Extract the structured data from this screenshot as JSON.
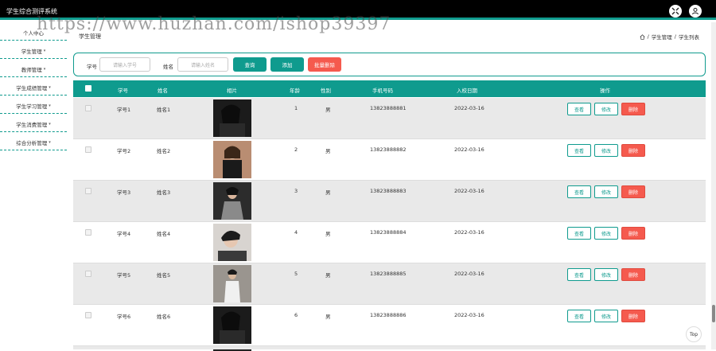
{
  "app": {
    "title": "学生综合测评系统"
  },
  "watermark": "https://www.huzhan.com/ishop39397",
  "sidebar": {
    "items": [
      {
        "label": "个人中心",
        "caret": ""
      },
      {
        "label": "学生管理",
        "caret": "▾"
      },
      {
        "label": "教师管理",
        "caret": "▾"
      },
      {
        "label": "学生成绩管理",
        "caret": "▾"
      },
      {
        "label": "学生学习管理",
        "caret": "▾"
      },
      {
        "label": "学生消费管理",
        "caret": "▾"
      },
      {
        "label": "综合分析管理",
        "caret": "▾"
      }
    ]
  },
  "page": {
    "title": "学生管理",
    "breadcrumb": {
      "level1": "学生管理",
      "separator": "/",
      "level2": "学生列表"
    }
  },
  "search": {
    "student_no_label": "学号",
    "student_no_placeholder": "请输入学号",
    "name_label": "姓名",
    "name_placeholder": "请输入姓名",
    "query_button": "查询",
    "add_button": "添加",
    "batch_delete_button": "批量删除"
  },
  "table": {
    "columns": [
      "学号",
      "姓名",
      "相片",
      "年龄",
      "性别",
      "手机号码",
      "入校日期",
      "操作"
    ],
    "actions": {
      "view": "查看",
      "edit": "修改",
      "delete": "删除"
    },
    "rows": [
      {
        "student_no": "学号1",
        "name": "姓名1",
        "age": "1",
        "gender": "男",
        "phone": "13823888881",
        "date": "2022-03-16"
      },
      {
        "student_no": "学号2",
        "name": "姓名2",
        "age": "2",
        "gender": "男",
        "phone": "13823888882",
        "date": "2022-03-16"
      },
      {
        "student_no": "学号3",
        "name": "姓名3",
        "age": "3",
        "gender": "男",
        "phone": "13823888883",
        "date": "2022-03-16"
      },
      {
        "student_no": "学号4",
        "name": "姓名4",
        "age": "4",
        "gender": "男",
        "phone": "13823888884",
        "date": "2022-03-16"
      },
      {
        "student_no": "学号5",
        "name": "姓名5",
        "age": "5",
        "gender": "男",
        "phone": "13823888885",
        "date": "2022-03-16"
      },
      {
        "student_no": "学号6",
        "name": "姓名6",
        "age": "6",
        "gender": "男",
        "phone": "13823888886",
        "date": "2022-03-16"
      }
    ]
  },
  "colors": {
    "accent": "#0f9b8e",
    "danger": "#f55a4e",
    "topbar": "#000000"
  },
  "icons": {
    "fullscreen": "fullscreen-icon",
    "user": "user-icon",
    "home": "home-icon"
  },
  "back_to_top": "Top"
}
